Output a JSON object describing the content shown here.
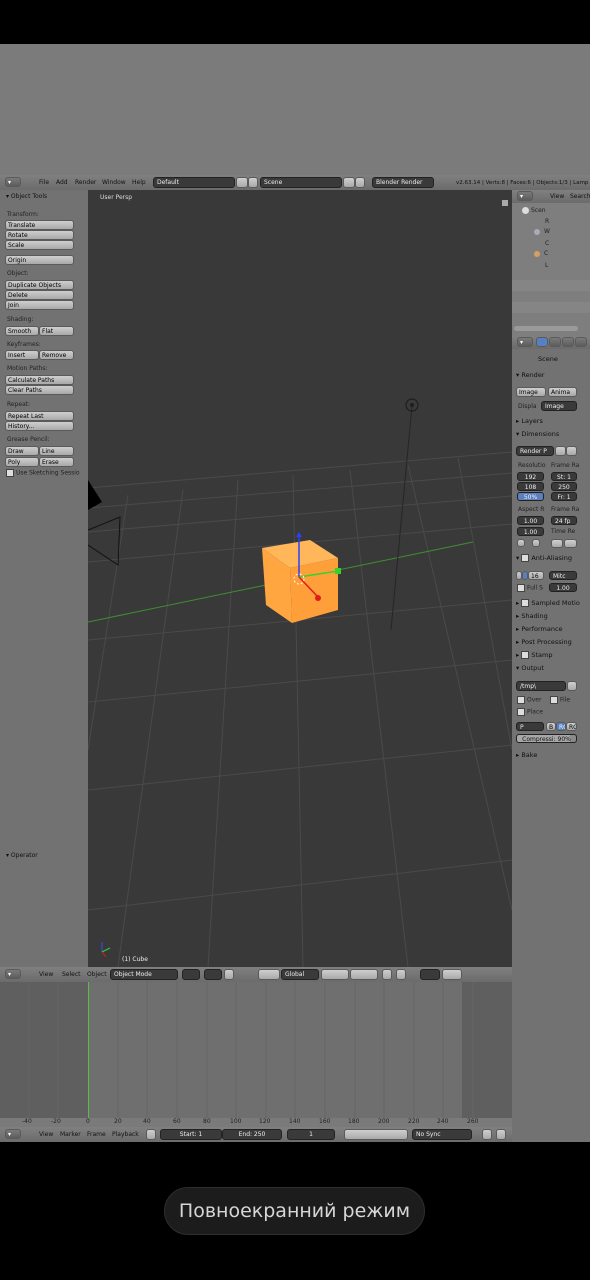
{
  "topbar": {
    "menus": [
      "File",
      "Add",
      "Render",
      "Window",
      "Help"
    ],
    "layout": "Default",
    "scene": "Scene",
    "engine": "Blender Render",
    "stats": "v2.63.14 | Verts:8 | Faces:6 | Objects:1/3 | Lamp"
  },
  "outliner": {
    "header": [
      "View",
      "Search"
    ],
    "items": [
      {
        "label": "Scene",
        "letter": "Scen"
      },
      {
        "label": "R"
      },
      {
        "label": "W"
      },
      {
        "label": "C"
      },
      {
        "label": "C"
      },
      {
        "label": "L"
      }
    ]
  },
  "tools": {
    "title": "Object Tools",
    "transform_label": "Transform:",
    "translate": "Translate",
    "rotate": "Rotate",
    "scale": "Scale",
    "origin": "Origin",
    "object_label": "Object:",
    "duplicate": "Duplicate Objects",
    "delete": "Delete",
    "join": "Join",
    "shading_label": "Shading:",
    "smooth": "Smooth",
    "flat": "Flat",
    "keyframes_label": "Keyframes:",
    "insert": "Insert",
    "remove": "Remove",
    "motion_label": "Motion Paths:",
    "calc_paths": "Calculate Paths",
    "clear_paths": "Clear Paths",
    "repeat_label": "Repeat:",
    "repeat_last": "Repeat Last",
    "history": "History...",
    "grease_label": "Grease Pencil:",
    "draw": "Draw",
    "line": "Line",
    "poly": "Poly",
    "erase": "Erase",
    "sketching": "Use Sketching Sessio",
    "operator": "Operator"
  },
  "viewport": {
    "label": "User Persp",
    "object_name": "(1) Cube",
    "header": {
      "view": "View",
      "select": "Select",
      "object": "Object",
      "mode": "Object Mode",
      "orientation": "Global"
    }
  },
  "properties": {
    "scene_label": "Scene",
    "render": "Render",
    "image_btn": "Image",
    "anim_btn": "Anima",
    "display_label": "Displa",
    "display_value": "Image",
    "layers": "Layers",
    "dimensions": "Dimensions",
    "render_preset": "Render P",
    "resolution_label": "Resolutio",
    "frame_range_label": "Frame Ra",
    "res_x": "192",
    "res_y": "108",
    "res_pct": "50%",
    "start": "St: 1",
    "end": "250",
    "step": "Fr: 1",
    "aspect_label": "Aspect R",
    "frame_rate_label": "Frame Ra",
    "aspect_x": "1.00",
    "aspect_y": "1.00",
    "fps": "24 fp",
    "time_label": "Time Re",
    "antialiasing": "Anti-Aliasing",
    "aa_16": "16",
    "aa_filter": "Mitc",
    "full_sample": "Full S",
    "aa_size": "1.00",
    "sampled_motion": "Sampled Motio",
    "shading": "Shading",
    "performance": "Performance",
    "post_processing": "Post Processing",
    "stamp": "Stamp",
    "output": "Output",
    "output_path": "/tmp\\",
    "overwrite": "Over",
    "file_ext": "File",
    "placeholders": "Place",
    "format_p": "P",
    "bw": "B",
    "rgb": "RG",
    "rgba": "RG",
    "compression": "Compressi: 90%",
    "bake": "Bake"
  },
  "timeline": {
    "ruler": [
      "-40",
      "-20",
      "0",
      "20",
      "40",
      "60",
      "80",
      "100",
      "120",
      "140",
      "160",
      "180",
      "200",
      "220",
      "240",
      "260"
    ],
    "header": {
      "view": "View",
      "marker": "Marker",
      "frame": "Frame",
      "playback": "Playback",
      "start": "Start: 1",
      "end": "End: 250",
      "current": "1",
      "sync": "No Sync"
    }
  },
  "android": {
    "fullscreen_button": "Повноекранний режим"
  }
}
